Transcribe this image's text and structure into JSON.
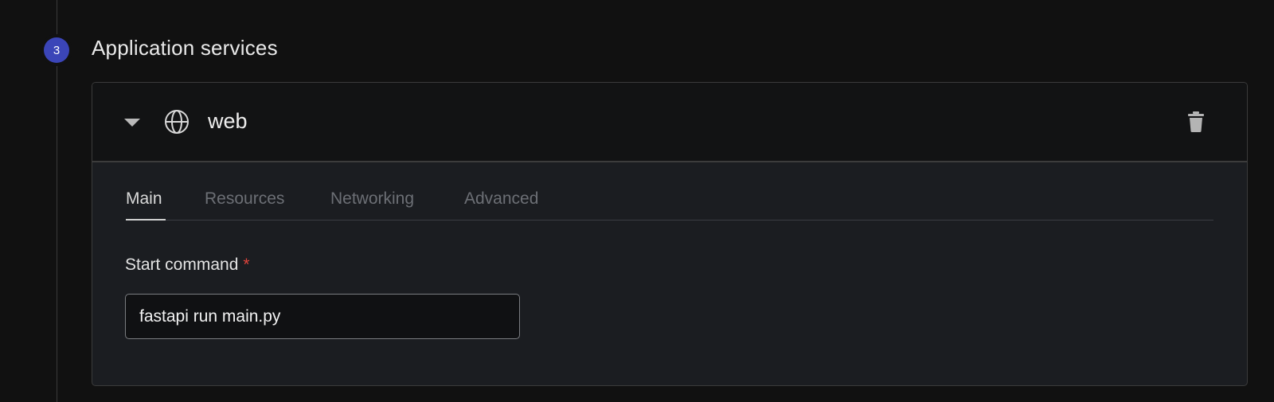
{
  "section": {
    "step_number": "3",
    "title": "Application services"
  },
  "service": {
    "name": "web",
    "icon": "globe-icon",
    "collapse_icon": "chevron-down-icon",
    "delete_icon": "trash-icon"
  },
  "tabs": [
    {
      "label": "Main",
      "active": true
    },
    {
      "label": "Resources",
      "active": false
    },
    {
      "label": "Networking",
      "active": false
    },
    {
      "label": "Advanced",
      "active": false
    }
  ],
  "start_command": {
    "label": "Start command",
    "required_mark": "*",
    "value": "fastapi run main.py"
  },
  "colors": {
    "background": "#111111",
    "step_badge": "#3b45b8",
    "card_body": "#1b1d21",
    "required": "#e0443c"
  }
}
